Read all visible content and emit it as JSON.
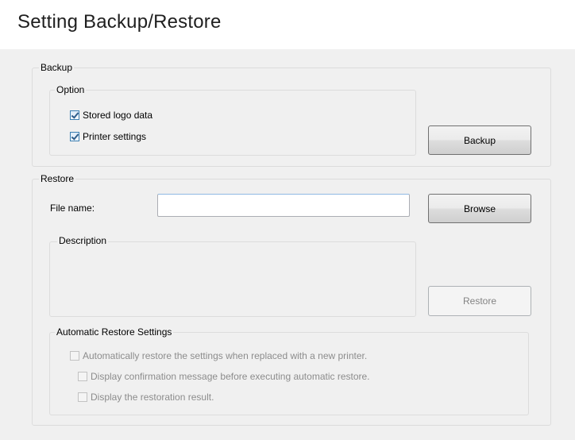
{
  "page": {
    "title": "Setting Backup/Restore"
  },
  "backup": {
    "group_label": "Backup",
    "option_label": "Option",
    "options": [
      {
        "label": "Stored logo data",
        "checked": true
      },
      {
        "label": "Printer settings",
        "checked": true
      }
    ],
    "button_label": "Backup"
  },
  "restore": {
    "group_label": "Restore",
    "file_name_label": "File name:",
    "file_name_value": "",
    "browse_label": "Browse",
    "description_label": "Description",
    "restore_button_label": "Restore",
    "auto": {
      "group_label": "Automatic Restore Settings",
      "options": [
        {
          "label": "Automatically restore the settings when replaced with a new printer.",
          "checked": false
        },
        {
          "label": "Display confirmation message before executing automatic restore.",
          "checked": false
        },
        {
          "label": "Display the restoration result.",
          "checked": false
        }
      ]
    }
  }
}
